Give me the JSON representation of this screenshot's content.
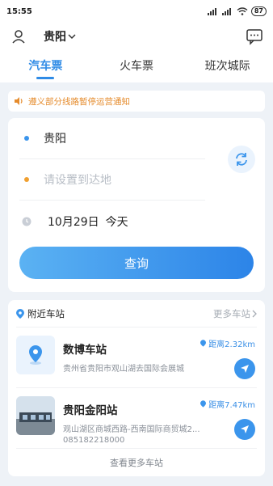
{
  "status": {
    "time": "15:55",
    "battery": "87"
  },
  "header": {
    "city": "贵阳",
    "city_icon": "chevron-down-icon"
  },
  "tabs": [
    {
      "label": "汽车票",
      "active": true
    },
    {
      "label": "火车票",
      "active": false
    },
    {
      "label": "班次城际",
      "active": false
    }
  ],
  "notice": {
    "text": "遵义部分线路暂停运营通知"
  },
  "search": {
    "from": "贵阳",
    "to_placeholder": "请设置到达地",
    "date": "10月29日",
    "day": "今天",
    "button": "查询"
  },
  "nearby": {
    "title": "附近车站",
    "more": "更多车站",
    "stations": [
      {
        "name": "数博车站",
        "address": "贵州省贵阳市观山湖去国际会展城",
        "distance": "距离2.32km",
        "phone": ""
      },
      {
        "name": "贵阳金阳站",
        "address": "观山湖区商城西路-西南国际商贸城2...",
        "distance": "距离7.47km",
        "phone": "085182218000"
      }
    ],
    "view_more": "查看更多车站"
  },
  "colors": {
    "accent": "#2f8be6",
    "notice": "#e58b2c",
    "from_dot": "#3b95ec",
    "to_dot": "#f0a030"
  }
}
